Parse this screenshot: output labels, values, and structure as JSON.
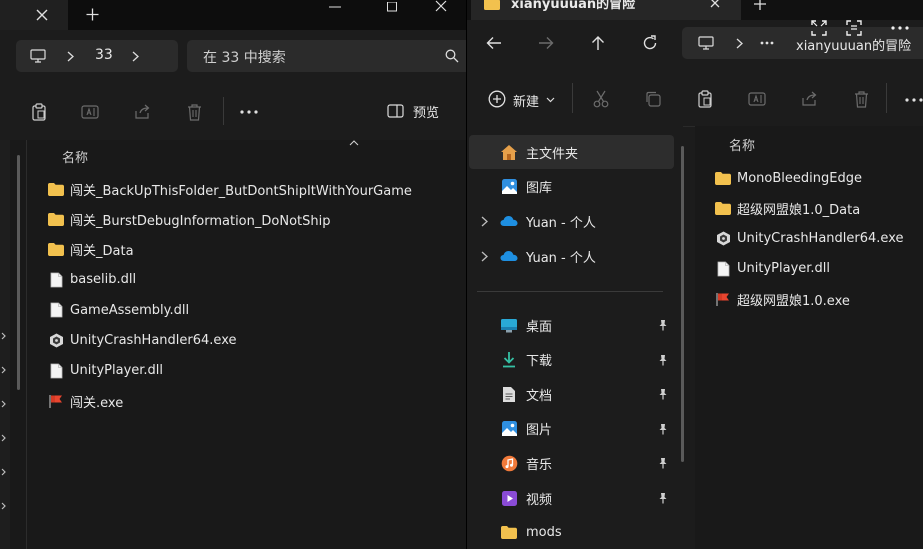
{
  "left": {
    "address": {
      "current": "33"
    },
    "search": {
      "placeholder": "在 33 中搜索"
    },
    "toolbar": {
      "preview_label": "预览"
    },
    "column_header": "名称",
    "files": [
      {
        "name": "闯关_BackUpThisFolder_ButDontShipItWithYourGame",
        "icon": "folder-icon"
      },
      {
        "name": "闯关_BurstDebugInformation_DoNotShip",
        "icon": "folder-icon"
      },
      {
        "name": "闯关_Data",
        "icon": "folder-icon"
      },
      {
        "name": "baselib.dll",
        "icon": "file-icon"
      },
      {
        "name": "GameAssembly.dll",
        "icon": "file-icon"
      },
      {
        "name": "UnityCrashHandler64.exe",
        "icon": "unity-icon"
      },
      {
        "name": "UnityPlayer.dll",
        "icon": "file-icon"
      },
      {
        "name": "闯关.exe",
        "icon": "flag-exe-icon"
      }
    ]
  },
  "right": {
    "tab_title": "xianyuuuan的冒险",
    "address": {
      "current": "xianyuuuan的冒险"
    },
    "toolbar": {
      "new_label": "新建"
    },
    "nav": {
      "pinned_top": [
        {
          "label": "主文件夹",
          "icon": "home-icon"
        },
        {
          "label": "图库",
          "icon": "gallery-icon"
        },
        {
          "label": "Yuan - 个人",
          "icon": "onedrive-icon"
        },
        {
          "label": "Yuan - 个人",
          "icon": "onedrive-icon"
        }
      ],
      "quick_access": [
        {
          "label": "桌面",
          "icon": "desktop-icon"
        },
        {
          "label": "下载",
          "icon": "download-icon"
        },
        {
          "label": "文档",
          "icon": "document-icon"
        },
        {
          "label": "图片",
          "icon": "pictures-icon"
        },
        {
          "label": "音乐",
          "icon": "music-icon"
        },
        {
          "label": "视频",
          "icon": "video-icon"
        },
        {
          "label": "mods",
          "icon": "folder-icon"
        }
      ]
    },
    "column_header": "名称",
    "files": [
      {
        "name": "MonoBleedingEdge",
        "icon": "folder-icon"
      },
      {
        "name": "超级网盟娘1.0_Data",
        "icon": "folder-icon"
      },
      {
        "name": "UnityCrashHandler64.exe",
        "icon": "unity-icon"
      },
      {
        "name": "UnityPlayer.dll",
        "icon": "file-icon"
      },
      {
        "name": "超级网盟娘1.0.exe",
        "icon": "flag-exe-icon"
      }
    ]
  },
  "colors": {
    "folder": "#f2c14e",
    "onedrive": "#1e8fe1",
    "accent_pin": "#cfcfcf"
  }
}
